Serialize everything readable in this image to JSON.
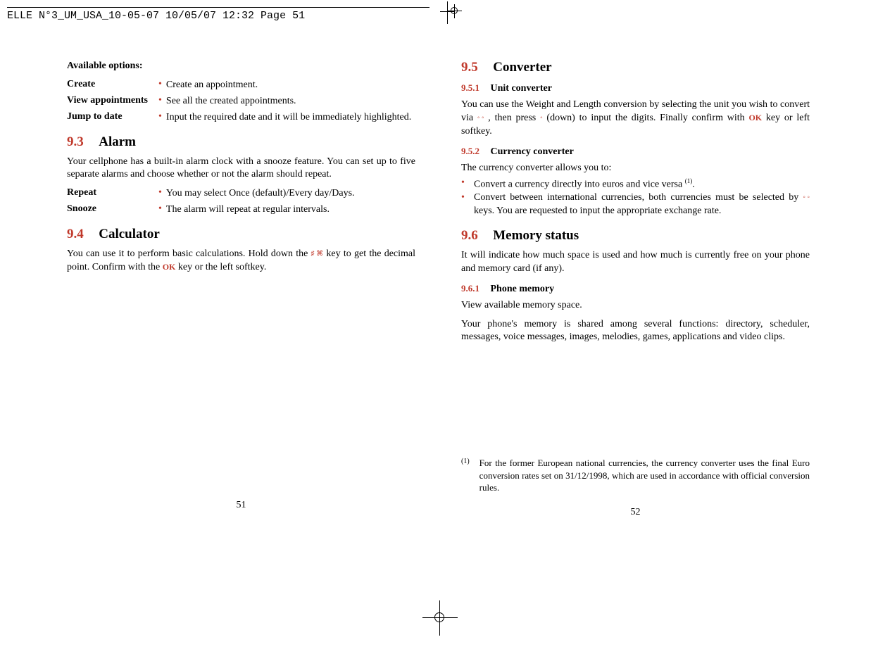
{
  "header": "ELLE N°3_UM_USA_10-05-07  10/05/07  12:32  Page 51",
  "left": {
    "available_options": "Available options:",
    "options": [
      {
        "label": "Create",
        "desc": "Create an appointment."
      },
      {
        "label": "View appointments",
        "desc": "See all the created appointments."
      },
      {
        "label": "Jump to date",
        "desc": "Input the required date and it will be immediately highlighted."
      }
    ],
    "s93_num": "9.3",
    "s93_title": "Alarm",
    "s93_para": "Your cellphone has a built-in alarm clock with a snooze feature. You can set up to five separate alarms and choose whether or not the alarm should repeat.",
    "s93_opts": [
      {
        "label": "Repeat",
        "desc": "You may select Once (default)/Every day/Days."
      },
      {
        "label": "Snooze",
        "desc": "The alarm will repeat at regular intervals."
      }
    ],
    "s94_num": "9.4",
    "s94_title": "Calculator",
    "s94_p_a": "You can use it to perform basic calculations. Hold down the ",
    "s94_p_b": " key to get the decimal point. Confirm with the ",
    "s94_p_c": " key or the left softkey.",
    "pgnum": "51"
  },
  "right": {
    "s95_num": "9.5",
    "s95_title": "Converter",
    "s951_num": "9.5.1",
    "s951_title": "Unit converter",
    "s951_a": "You can use the Weight and Length conversion by selecting the unit you wish to convert via ",
    "s951_b": ", then press ",
    "s951_c": " (down) to input the digits. Finally confirm with ",
    "s951_d": " key or left softkey.",
    "s952_num": "9.5.2",
    "s952_title": "Currency converter",
    "s952_intro": "The currency converter allows you to:",
    "s952_b1": "Convert a currency directly into euros and vice versa ",
    "s952_b1_sup": "(1)",
    "s952_b1_end": ".",
    "s952_b2a": "Convert between international currencies, both currencies must be selected by ",
    "s952_b2b": " keys. You are requested to input the appropriate exchange rate.",
    "s96_num": "9.6",
    "s96_title": "Memory status",
    "s96_para": "It will indicate how much space is used and how much is currently free on your phone and memory card (if any).",
    "s961_num": "9.6.1",
    "s961_title": "Phone memory",
    "s961_p1": "View available memory space.",
    "s961_p2": "Your phone's memory is shared among several functions: directory, scheduler, messages, voice messages, images, melodies, games, applications and video clips.",
    "fn_mark": "(1)",
    "fn_txt": "For the former European national currencies, the currency converter uses the final Euro conversion rates set on 31/12/1998, which are used in accordance with official conversion rules.",
    "pgnum": "52"
  },
  "ok_label": "OK"
}
